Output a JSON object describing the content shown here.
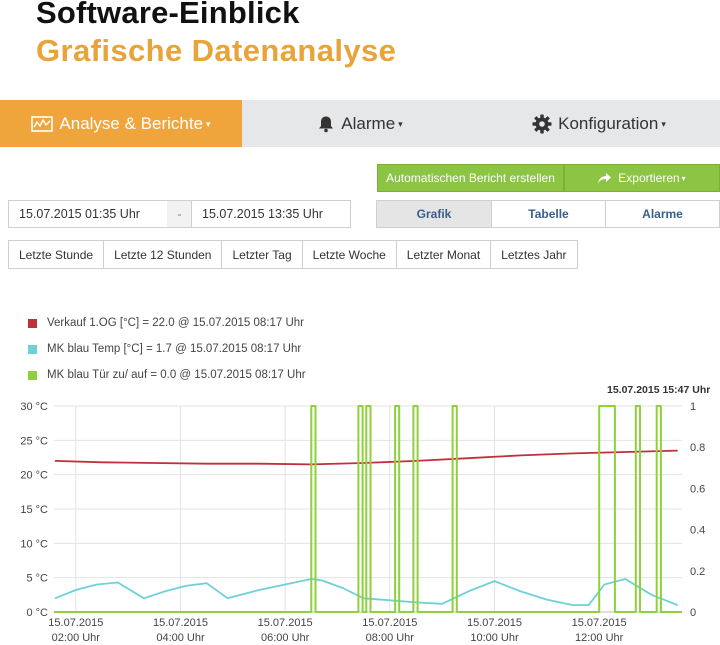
{
  "header": {
    "title": "Software-Einblick",
    "subtitle": "Grafische Datenanalyse"
  },
  "nav": {
    "items": [
      {
        "label": "Analyse & Berichte",
        "icon": "chart-icon",
        "active": true
      },
      {
        "label": "Alarme",
        "icon": "bell-icon",
        "active": false
      },
      {
        "label": "Konfiguration",
        "icon": "gear-icon",
        "active": false
      }
    ],
    "caret": "▾"
  },
  "actions": {
    "auto_report": "Automatischen Bericht erstellen",
    "export": "Exportieren",
    "export_icon": "share-icon"
  },
  "date_range": {
    "from": "15.07.2015 01:35 Uhr",
    "separator": "-",
    "to": "15.07.2015 13:35 Uhr"
  },
  "view_tabs": [
    {
      "label": "Grafik",
      "active": true
    },
    {
      "label": "Tabelle",
      "active": false
    },
    {
      "label": "Alarme",
      "active": false
    }
  ],
  "quick_ranges": [
    "Letzte Stunde",
    "Letzte 12 Stunden",
    "Letzter Tag",
    "Letzte Woche",
    "Letzter Monat",
    "Letztes Jahr"
  ],
  "legend": [
    {
      "label": "Verkauf 1.OG [°C] = 22.0 @ 15.07.2015 08:17 Uhr",
      "color": "#c0303a"
    },
    {
      "label": "MK blau Temp [°C] = 1.7 @ 15.07.2015 08:17 Uhr",
      "color": "#6fd0d8"
    },
    {
      "label": "MK blau Tür zu/ auf = 0.0 @ 15.07.2015 08:17 Uhr",
      "color": "#8ed13c"
    }
  ],
  "timestamp": "15.07.2015 15:47 Uhr",
  "chart_data": {
    "type": "line",
    "x_range": [
      "15.07.2015 01:35",
      "15.07.2015 13:35"
    ],
    "x_ticks": [
      {
        "date": "15.07.2015",
        "time": "02:00 Uhr",
        "h": 2.0
      },
      {
        "date": "15.07.2015",
        "time": "04:00 Uhr",
        "h": 4.0
      },
      {
        "date": "15.07.2015",
        "time": "06:00 Uhr",
        "h": 6.0
      },
      {
        "date": "15.07.2015",
        "time": "08:00 Uhr",
        "h": 8.0
      },
      {
        "date": "15.07.2015",
        "time": "10:00 Uhr",
        "h": 10.0
      },
      {
        "date": "15.07.2015",
        "time": "12:00 Uhr",
        "h": 12.0
      }
    ],
    "y_left": {
      "ticks": [
        "0 °C",
        "5 °C",
        "10 °C",
        "15 °C",
        "20 °C",
        "25 °C",
        "30 °C"
      ],
      "values": [
        0,
        5,
        10,
        15,
        20,
        25,
        30
      ],
      "ylim": [
        0,
        30
      ]
    },
    "y_right": {
      "ticks": [
        "0",
        "0.2",
        "0.4",
        "0.6",
        "0.8",
        "1"
      ],
      "values": [
        0,
        0.2,
        0.4,
        0.6,
        0.8,
        1
      ],
      "ylim": [
        0,
        1
      ]
    },
    "grid": true,
    "series": [
      {
        "name": "Verkauf 1.OG [°C]",
        "color": "#c0303a",
        "axis": "left",
        "x": [
          1.6,
          2.5,
          3.5,
          4.5,
          5.5,
          6.5,
          7.5,
          8.5,
          9.5,
          10.5,
          11.5,
          12.5,
          13.5
        ],
        "y": [
          22.0,
          21.8,
          21.7,
          21.6,
          21.6,
          21.5,
          21.7,
          22.0,
          22.4,
          22.8,
          23.1,
          23.3,
          23.5
        ]
      },
      {
        "name": "MK blau Temp [°C]",
        "color": "#6fd0d8",
        "axis": "left",
        "x": [
          1.6,
          2.0,
          2.4,
          2.8,
          3.3,
          3.7,
          4.1,
          4.5,
          4.9,
          5.5,
          6.0,
          6.5,
          6.7,
          7.1,
          7.5,
          8.0,
          8.5,
          9.0,
          9.5,
          10.0,
          10.5,
          11.0,
          11.5,
          11.8,
          12.1,
          12.5,
          13.0,
          13.5
        ],
        "y": [
          2.0,
          3.2,
          4.0,
          4.3,
          2.0,
          3.0,
          3.8,
          4.2,
          2.0,
          3.2,
          4.0,
          4.8,
          4.6,
          3.5,
          2.0,
          1.7,
          1.4,
          1.2,
          3.0,
          4.5,
          3.0,
          1.8,
          1.0,
          1.0,
          4.0,
          4.8,
          2.5,
          1.0
        ]
      },
      {
        "name": "MK blau Tür zu/ auf",
        "color": "#8ed13c",
        "axis": "right",
        "open_intervals": [
          [
            6.5,
            6.58
          ],
          [
            7.4,
            7.48
          ],
          [
            7.55,
            7.63
          ],
          [
            8.1,
            8.18
          ],
          [
            8.45,
            8.53
          ],
          [
            9.2,
            9.28
          ],
          [
            12.0,
            12.3
          ],
          [
            12.7,
            12.78
          ],
          [
            13.1,
            13.18
          ]
        ]
      }
    ]
  }
}
